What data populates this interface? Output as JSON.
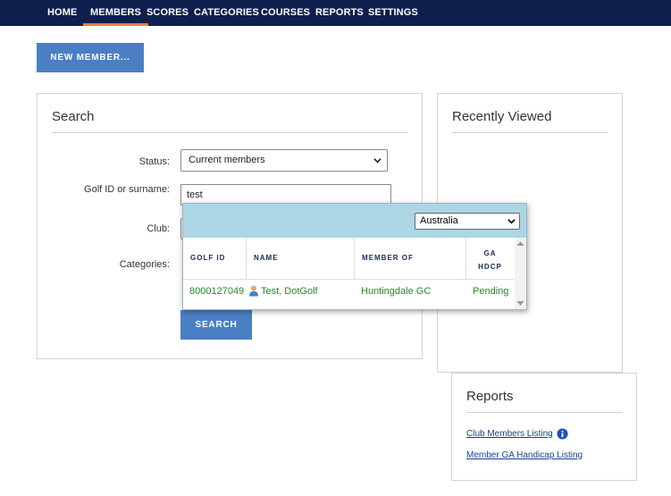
{
  "nav": {
    "items": [
      {
        "label": "HOME"
      },
      {
        "label": "MEMBERS",
        "active": true
      },
      {
        "label": "SCORES"
      },
      {
        "label": "CATEGORIES"
      },
      {
        "label": "COURSES"
      },
      {
        "label": "REPORTS"
      },
      {
        "label": "SETTINGS"
      }
    ]
  },
  "toolbar": {
    "new_member_label": "NEW MEMBER..."
  },
  "search": {
    "title": "Search",
    "status_label": "Status:",
    "status_value": "Current members",
    "golfid_label": "Golf ID or surname:",
    "golfid_value": "test",
    "club_label": "Club:",
    "categories_label": "Categories:",
    "search_button": "SEARCH"
  },
  "recently_viewed": {
    "title": "Recently Viewed"
  },
  "autocomplete": {
    "country": "Australia",
    "headers": {
      "golf_id": "GOLF ID",
      "name": "NAME",
      "member_of": "MEMBER OF",
      "ga": "GA",
      "hdcp": "HDCP"
    },
    "rows": [
      {
        "golf_id": "8000127049",
        "name": "Test, DotGolf",
        "member_of": "Huntingdale GC",
        "ga_hdcp": "Pending"
      }
    ]
  },
  "reports": {
    "title": "Reports",
    "links": [
      {
        "label": "Club Members Listing"
      },
      {
        "label": "Member GA Handicap Listing"
      }
    ]
  },
  "colors": {
    "nav_bg": "#0d1f4d",
    "nav_active_underline": "#e8813a",
    "button_blue": "#4a7fc4",
    "popup_header": "#acd6e4",
    "row_text_green": "#1f8a2a"
  }
}
